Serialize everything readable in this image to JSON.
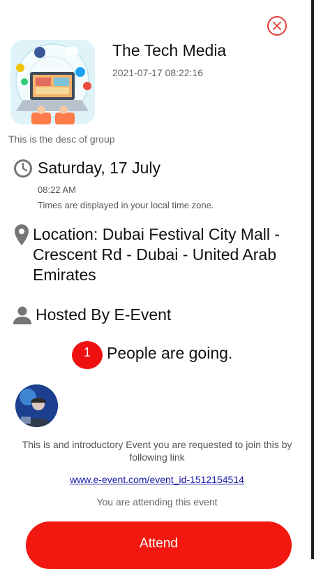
{
  "group": {
    "title": "The Tech Media",
    "timestamp": "2021-07-17 08:22:16",
    "description": "This is the desc of group"
  },
  "event": {
    "date": "Saturday, 17 July",
    "time": "08:22 AM",
    "timezone_note": "Times are displayed in your local time zone.",
    "location": "Location: Dubai Festival City Mall - Crescent Rd - Dubai - United Arab Emirates",
    "host": "Hosted By E-Event",
    "going_count": "1",
    "going_label": "People are going.",
    "intro": "This is and introductory Event you are requested to join this by following link",
    "link": "www.e-event.com/event_id-1512154514",
    "attending_status": "You are attending this event",
    "attend_label": "Attend"
  },
  "icons": {
    "close": "close-icon",
    "clock": "clock-icon",
    "location": "location-pin-icon",
    "host": "person-icon"
  },
  "colors": {
    "accent": "#f2170f",
    "badge": "#ee1111",
    "link": "#1a1aa6",
    "icon_gray": "#757575"
  }
}
